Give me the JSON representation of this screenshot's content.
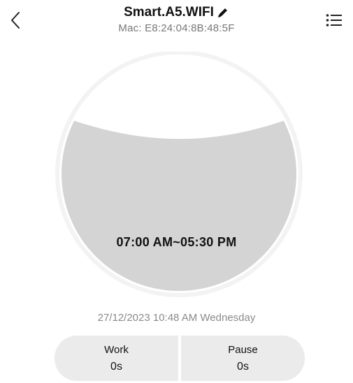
{
  "header": {
    "title": "Smart.A5.WIFI",
    "mac": "Mac:  E8:24:04:8B:48:5F",
    "back_icon": "chevron-left-icon",
    "edit_icon": "pencil-icon",
    "menu_icon": "list-icon"
  },
  "dial": {
    "schedule": "07:00 AM~05:30 PM",
    "fill_color": "#d4d4d4",
    "ring_color": "#f3f3f3"
  },
  "datetime": "27/12/2023 10:48 AM Wednesday",
  "stats": {
    "work_label": "Work",
    "work_value": "0s",
    "pause_label": "Pause",
    "pause_value": "0s"
  }
}
